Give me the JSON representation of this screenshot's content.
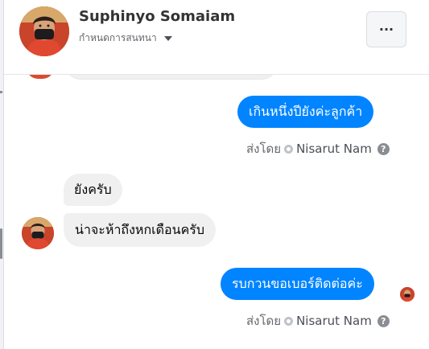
{
  "header": {
    "contact_name": "Suphinyo Somaiam",
    "topic_label": "กำหนดการสนทนา",
    "more_label": "···"
  },
  "messages": [
    {
      "direction": "out",
      "text": "เกินหนึ่งปียังค่ะลูกค้า"
    },
    {
      "direction": "in",
      "text": "ยังครับ"
    },
    {
      "direction": "in",
      "text": "น่าจะห้าถึงหกเดือนครับ"
    },
    {
      "direction": "out",
      "text": "รบกวนขอเบอร์ติดต่อค่ะ"
    }
  ],
  "sent_by": {
    "label": "ส่งโดย",
    "sender": "Nisarut Nam",
    "help": "?"
  },
  "colors": {
    "outgoing_bubble": "#0084ff",
    "incoming_bubble": "#f0f0f0",
    "avatar_red": "#d94b2e"
  },
  "icons": [
    "chevron-down-icon",
    "more-icon",
    "verified-dot-icon",
    "help-icon"
  ]
}
